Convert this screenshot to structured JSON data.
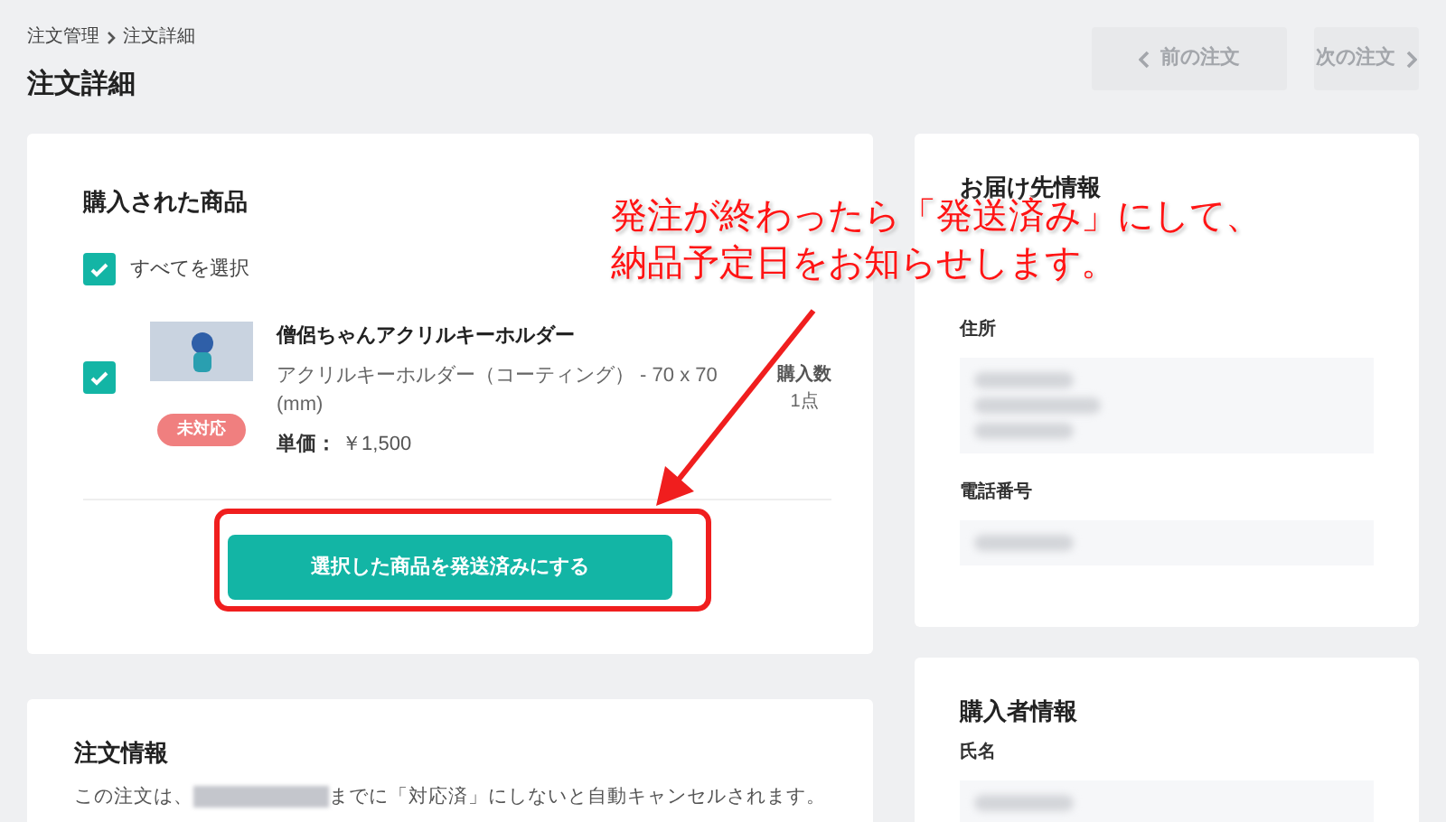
{
  "breadcrumb": [
    "注文管理",
    "注文詳細"
  ],
  "title": "注文詳細",
  "nav_buttons": [
    {
      "label": "前の注文",
      "kind": "prev",
      "disabled": true
    },
    {
      "label": "次の注文",
      "kind": "next",
      "disabled": true
    }
  ],
  "purchased_items": {
    "title": "購入された商品",
    "select_all": {
      "label": "すべてを選択",
      "checked": true
    },
    "items": [
      {
        "name": "僧侶ちゃんアクリルキーホルダー",
        "variant": "アクリルキーホルダー（コーティング） - 70 x 70 (mm)",
        "price_label": "単価：",
        "price": "￥1,500",
        "status": "未対応",
        "quantity_label": "購入数",
        "quantity": "1点",
        "checked": true
      }
    ],
    "action": "選択した商品を発送済みにする"
  },
  "order_info": {
    "title": "注文情報",
    "notice_before": "この注文は、",
    "notice_after": "までに「対応済」にしないと自動キャンセルされます。"
  },
  "delivery": {
    "title": "お届け先情報",
    "fields": [
      {
        "label": "住所"
      },
      {
        "label": "電話番号"
      }
    ]
  },
  "buyer": {
    "title": "購入者情報",
    "fields": [
      {
        "label": "氏名"
      }
    ]
  },
  "callout": {
    "lines": [
      "発注が終わったら「発送済み」にして、",
      "納品予定日をお知らせします。"
    ]
  }
}
